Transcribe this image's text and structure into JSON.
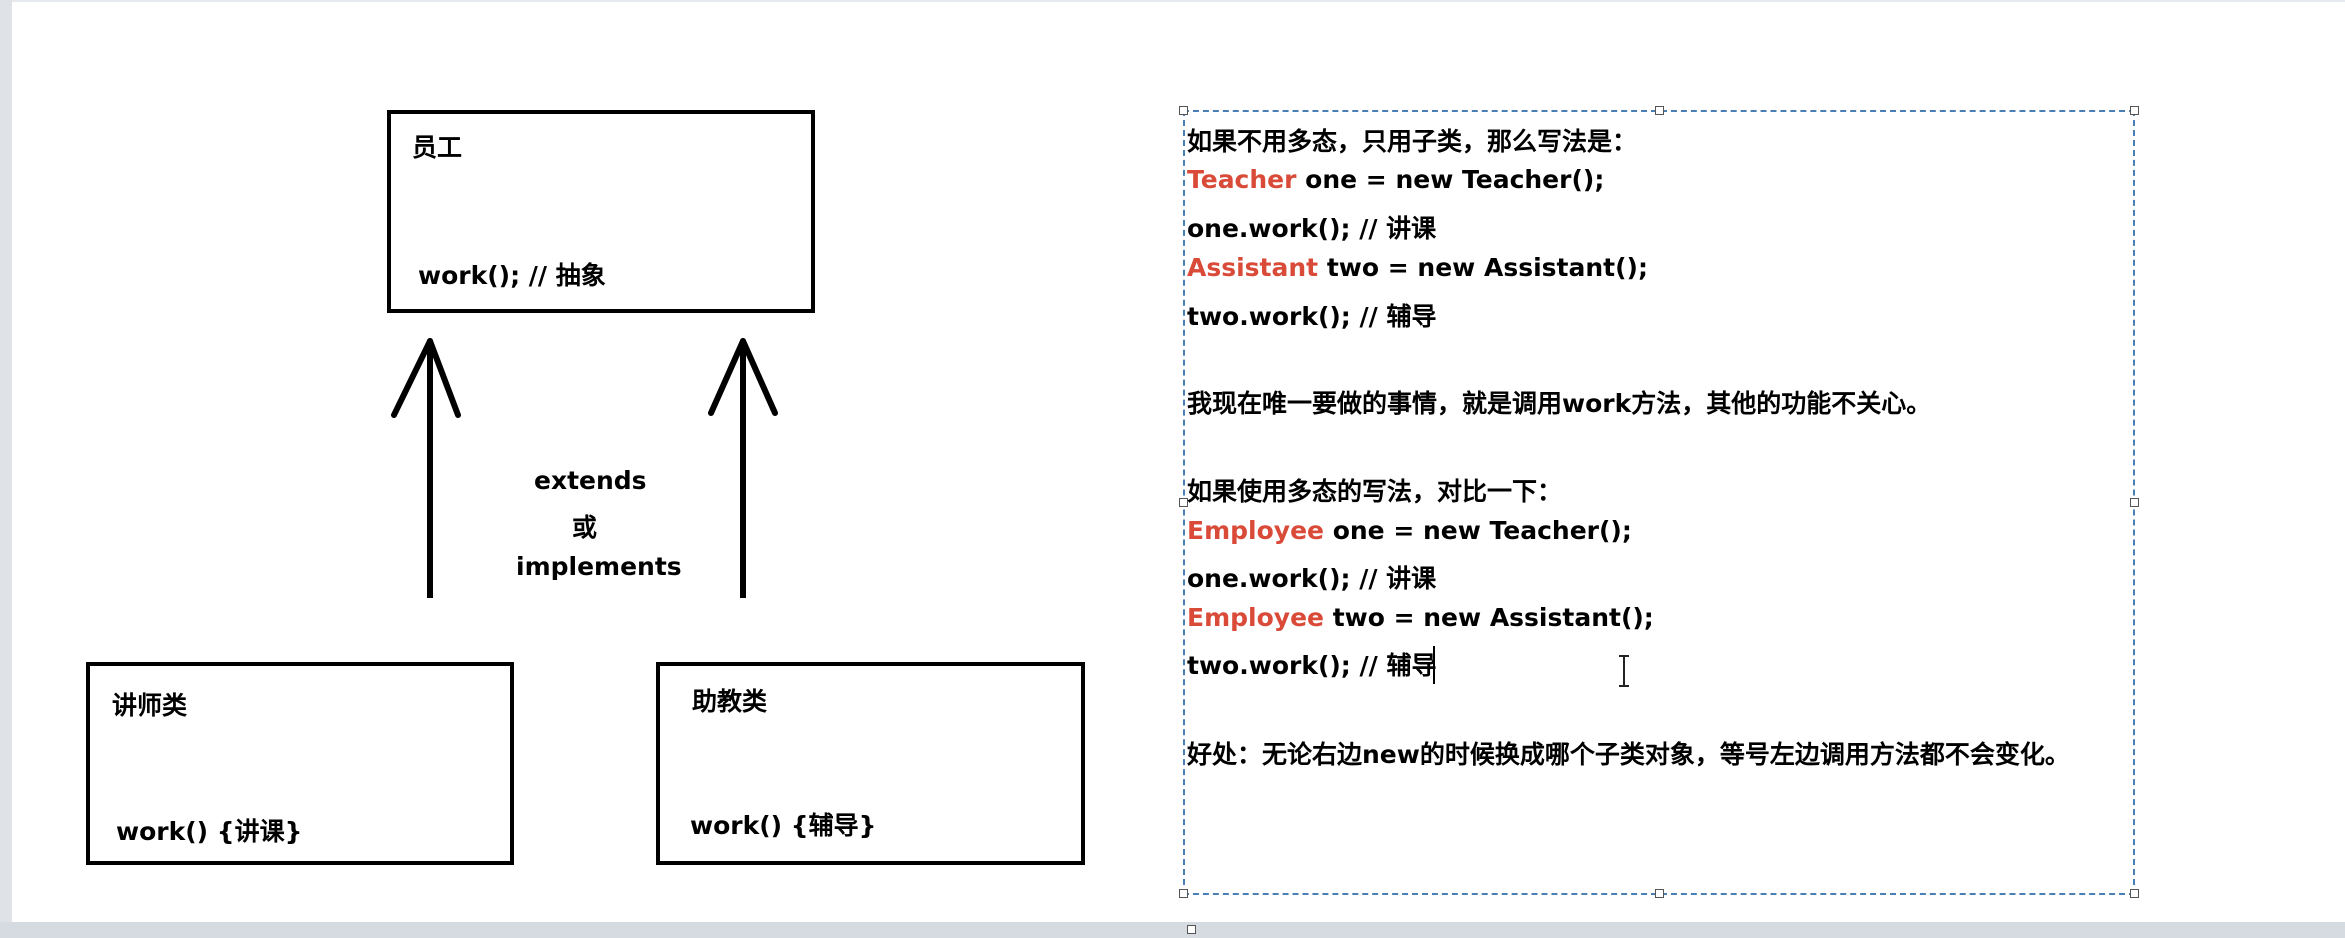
{
  "diagram": {
    "employee": {
      "title": "员工",
      "method": "work(); // 抽象"
    },
    "teacher": {
      "title": "讲师类",
      "method": "work() {讲课}"
    },
    "assistant": {
      "title": "助教类",
      "method": "work() {辅导}"
    },
    "relation": {
      "line1": "extends",
      "line2": "或",
      "line3": "implements"
    }
  },
  "notes": {
    "l1": {
      "text": "如果不用多态，只用子类，那么写法是："
    },
    "l2": {
      "red": "Teacher",
      "rest": " one = new Teacher();"
    },
    "l3": {
      "text": "one.work(); // 讲课"
    },
    "l4": {
      "red": "Assistant",
      "rest": " two = new Assistant();"
    },
    "l5": {
      "text": "two.work(); // 辅导"
    },
    "l6": {
      "text": "我现在唯一要做的事情，就是调用work方法，其他的功能不关心。"
    },
    "l7": {
      "text": "如果使用多态的写法，对比一下："
    },
    "l8": {
      "red": "Employee",
      "rest": " one = new Teacher();"
    },
    "l9": {
      "text": "one.work(); // 讲课"
    },
    "l10": {
      "red": "Employee",
      "rest": " two = new Assistant();"
    },
    "l11": {
      "text": "two.work(); // 辅导"
    },
    "l12": {
      "text": "好处：无论右边new的时候换成哪个子类对象，等号左边调用方法都不会变化。"
    }
  },
  "colors": {
    "keyword": "#d94a38",
    "selection_border": "#4a7fb5",
    "text": "#000000"
  }
}
